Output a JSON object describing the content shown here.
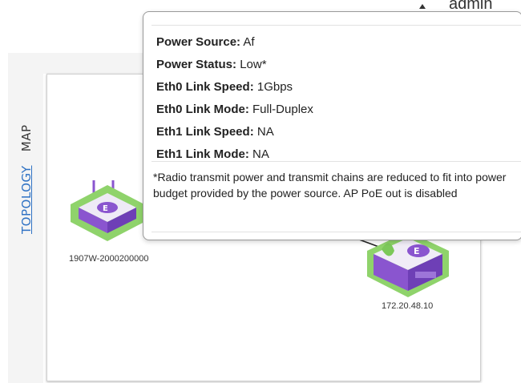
{
  "header": {
    "user_name": "admin"
  },
  "tabs": {
    "topology": "TOPOLOGY",
    "map": "MAP"
  },
  "devices": [
    {
      "label": "1907W-2000200000"
    },
    {
      "label": "172.20.48.10"
    }
  ],
  "tooltip": {
    "rows": [
      {
        "key": "Power Source:",
        "value": "Af"
      },
      {
        "key": "Power Status:",
        "value": "Low*"
      },
      {
        "key": "Eth0 Link Speed:",
        "value": "1Gbps"
      },
      {
        "key": "Eth0 Link Mode:",
        "value": "Full-Duplex"
      },
      {
        "key": "Eth1 Link Speed:",
        "value": "NA"
      },
      {
        "key": "Eth1 Link Mode:",
        "value": "NA"
      }
    ],
    "note": "*Radio transmit power and transmit chains are reduced to fit into power budget provided by the power source. AP PoE out is disabled"
  },
  "colors": {
    "accent": "#2f72c4",
    "device_green": "#8fd36b",
    "device_purple": "#8a55cf"
  }
}
